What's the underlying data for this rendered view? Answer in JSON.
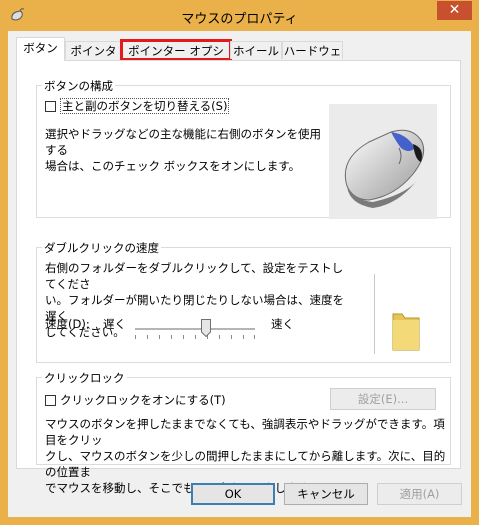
{
  "window": {
    "title": "マウスのプロパティ",
    "close_glyph": "✕"
  },
  "tabs": [
    {
      "label": "ボタン",
      "active": true
    },
    {
      "label": "ポインター"
    },
    {
      "label": "ポインター オプション",
      "highlighted": true
    },
    {
      "label": "ホイール"
    },
    {
      "label": "ハードウェア"
    }
  ],
  "button_config": {
    "title": "ボタンの構成",
    "swap_checkbox_label": "主と副のボタンを切り替える(S)",
    "swap_checked": false,
    "description_line1": "選択やドラッグなどの主な機能に右側のボタンを使用する",
    "description_line2": "場合は、このチェック ボックスをオンにします。"
  },
  "double_click": {
    "title": "ダブルクリックの速度",
    "description_line1": "右側のフォルダーをダブルクリックして、設定をテストしてくださ",
    "description_line2": "い。フォルダーが開いたり閉じたりしない場合は、速度を遅く",
    "description_line3": "してください。",
    "speed_label": "速度(D):",
    "slow_label": "遅く",
    "fast_label": "速く",
    "speed_fraction": 0.6
  },
  "click_lock": {
    "title": "クリックロック",
    "checkbox_label": "クリックロックをオンにする(T)",
    "checked": false,
    "settings_button": "設定(E)...",
    "description_line1": "マウスのボタンを押したままでなくても、強調表示やドラッグができます。項目をクリッ",
    "description_line2": "クし、マウスのボタンを少しの間押したままにしてから離します。次に、目的の位置ま",
    "description_line3": "でマウスを移動し、そこでもう一度クリックします。"
  },
  "footer": {
    "ok": "OK",
    "cancel": "キャンセル",
    "apply": "適用(A)"
  },
  "colors": {
    "titlebar": "#eab04a",
    "close_button": "#c7502e",
    "highlight_outline": "#e21a1a",
    "default_button_border": "#3c7fb1"
  }
}
